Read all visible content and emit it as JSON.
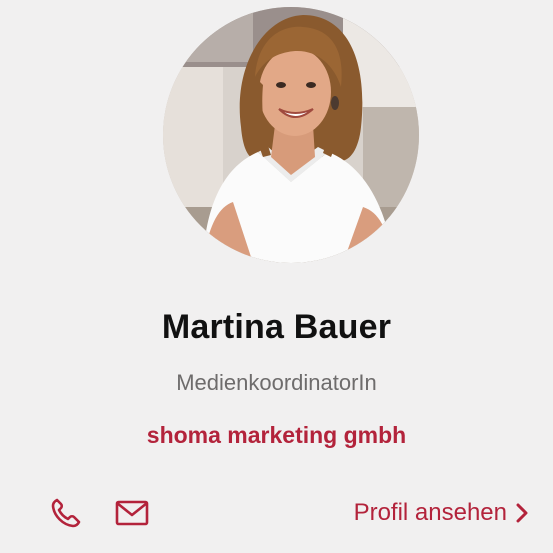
{
  "profile": {
    "name": "Martina Bauer",
    "role": "MedienkoordinatorIn",
    "company": "shoma marketing gmbh"
  },
  "actions": {
    "phone_icon": "phone-icon",
    "mail_icon": "mail-icon",
    "profile_link_label": "Profil ansehen",
    "profile_link_icon": "chevron-right-icon"
  },
  "colors": {
    "accent": "#b3233b",
    "background": "#f1f0f0",
    "name_text": "#111111",
    "role_text": "#6e6c6c"
  }
}
